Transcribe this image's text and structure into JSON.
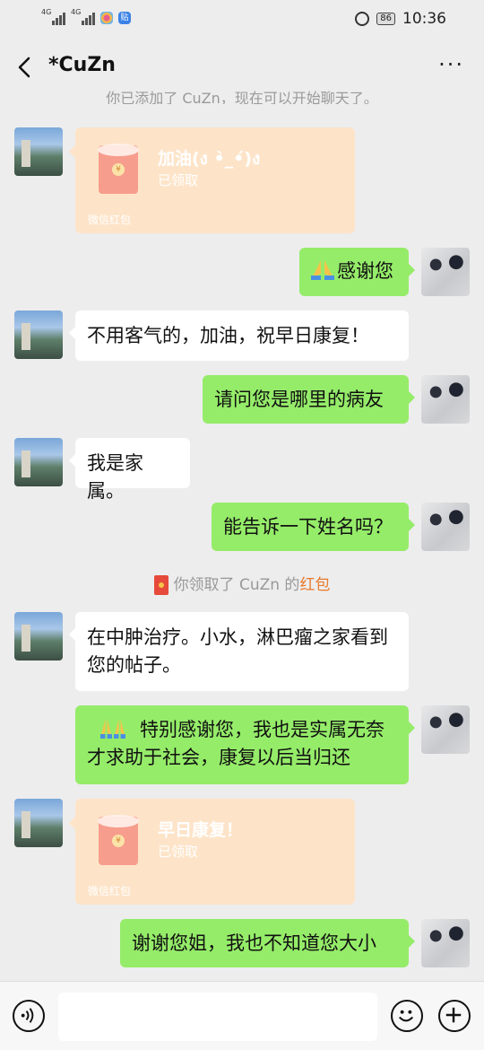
{
  "status_bar": {
    "signal1": "4G",
    "signal2": "4G",
    "battery": "86",
    "time": "10:36",
    "app_icon_label": "贴"
  },
  "header": {
    "title": "*CuZn",
    "more": "···"
  },
  "system_top": "你已添加了 CuZn，现在可以开始聊天了。",
  "messages": {
    "m1": {
      "title": "加油(ง •̀_•́)ง",
      "status": "已领取",
      "footer": "微信红包",
      "coin": "¥"
    },
    "m2": {
      "text": "感谢您"
    },
    "m3": {
      "text": "不用客气的，加油，祝早日康复！"
    },
    "m4": {
      "text": "请问您是哪里的病友"
    },
    "m5": {
      "text": "我是家属。"
    },
    "m6": {
      "text": "能告诉一下姓名吗？"
    },
    "m7": {
      "text": "在中肿治疗。小水，淋巴瘤之家看到您的帖子。"
    },
    "m8": {
      "text": "特别感谢您，我也是实属无奈才求助于社会，康复以后当归还"
    },
    "m9": {
      "title": "早日康复！",
      "status": "已领取",
      "footer": "微信红包",
      "coin": "¥"
    },
    "m10": {
      "text": "谢谢您姐，我也不知道您大小"
    }
  },
  "system_mid": {
    "prefix": "你领取了 CuZn 的",
    "highlight": "红包"
  },
  "colors": {
    "sent_bubble": "#95EC69",
    "received_bubble": "#FFFFFF",
    "red_packet": "#FDE4C9",
    "background": "#EDEDED",
    "highlight": "#E87A2C"
  },
  "icons": {
    "back": "chevron-left-icon",
    "voice": "voice-icon",
    "emoji": "smiley-icon",
    "plus": "plus-icon",
    "alarm": "alarm-icon",
    "praying": "praying-hands-emoji"
  }
}
